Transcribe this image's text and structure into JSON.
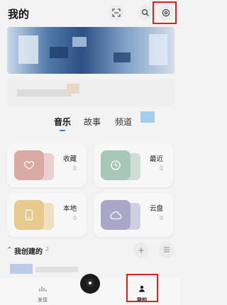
{
  "header": {
    "title": "我的",
    "icons": [
      "scan-icon",
      "search-icon",
      "settings-icon"
    ],
    "highlight_color": "#e02020"
  },
  "content_tabs": [
    {
      "label": "音乐",
      "active": true
    },
    {
      "label": "故事",
      "active": false
    },
    {
      "label": "频道",
      "active": false
    }
  ],
  "cards": [
    {
      "label": "收藏",
      "count": "0",
      "icon": "heart-icon",
      "color": "#d9a9a4"
    },
    {
      "label": "最近",
      "count": "0",
      "icon": "clock-icon",
      "color": "#a7c7b8"
    },
    {
      "label": "本地",
      "count": "0",
      "icon": "phone-icon",
      "color": "#e8c98e"
    },
    {
      "label": "云盘",
      "count": "0",
      "icon": "cloud-icon",
      "color": "#a9a6c9"
    }
  ],
  "created_section": {
    "title": "我创建的",
    "count": "2",
    "icons": [
      "plus-icon",
      "list-icon"
    ]
  },
  "bottom_nav": {
    "discover_label": "发现",
    "mine_label": "我的",
    "accent": "#2b7fd8"
  }
}
